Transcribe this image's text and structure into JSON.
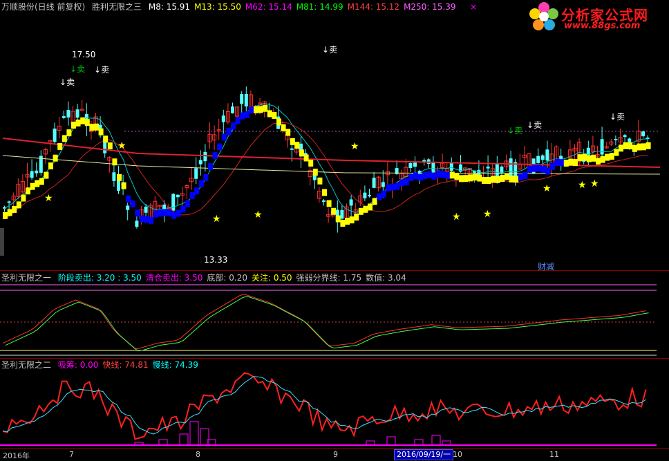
{
  "header": {
    "stock": "万顺股份(日线 前复权)",
    "indicator": "胜利无限之三",
    "ma": [
      {
        "label": "M8: 15.91",
        "color": "#ffffff"
      },
      {
        "label": "M13: 15.50",
        "color": "#ffff00"
      },
      {
        "label": "M62: 15.14",
        "color": "#ff00ff"
      },
      {
        "label": "M81: 14.99",
        "color": "#00ff00"
      },
      {
        "label": "M144: 15.12",
        "color": "#ff4040"
      },
      {
        "label": "M250: 15.39",
        "color": "#ff60ff"
      }
    ],
    "close_mark": "×"
  },
  "logo": {
    "title": "分析家公式网",
    "url": "www.88gs.com"
  },
  "price_labels": {
    "high": "17.50",
    "low": "13.33",
    "sell": "卖",
    "finance": "财减"
  },
  "pane2": {
    "title": "圣利无限之一",
    "items": [
      {
        "label": "阶段卖出: 3.20 : 3.50",
        "color": "#00ffff"
      },
      {
        "label": "清仓卖出: 3.50",
        "color": "#ff00ff"
      },
      {
        "label": "底部: 0.20",
        "color": "#c0c0c0"
      },
      {
        "label": "关注: 0.50",
        "color": "#ffff00"
      },
      {
        "label": "强弱分界线: 1.75",
        "color": "#c0c0c0"
      },
      {
        "label": "数值: 3.04",
        "color": "#c0c0c0"
      }
    ]
  },
  "pane3": {
    "title": "圣利无限之二",
    "items": [
      {
        "label": "吸筹: 0.00",
        "color": "#ff00ff"
      },
      {
        "label": "快线: 74.81",
        "color": "#ff4040"
      },
      {
        "label": "慢线: 74.39",
        "color": "#00ffff"
      }
    ]
  },
  "xaxis": {
    "labels": [
      "2016年",
      "7",
      "8",
      "9",
      "10",
      "11"
    ],
    "cursor_date": "2016/09/19/一"
  },
  "colors": {
    "up": "#ff3232",
    "down": "#54ffff",
    "stair_up": "#ffff00",
    "stair_down": "#0000ff"
  }
}
